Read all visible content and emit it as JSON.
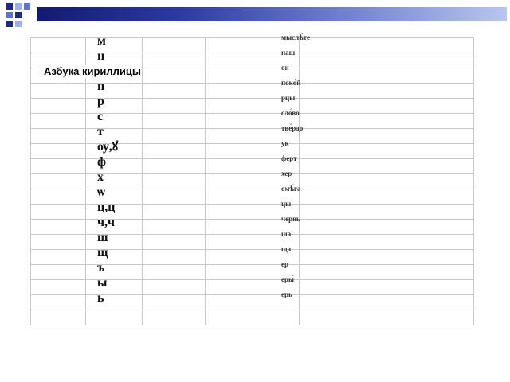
{
  "title": "Азбука кириллицы",
  "theme": {
    "bar_colors": [
      "#131a6e",
      "#b9c6ee"
    ],
    "square_colors": [
      "#1f2a7a",
      "#5f73c8",
      "#9fb0e4"
    ]
  },
  "rows": [
    {
      "letter": "м",
      "name": "мыслѣ́те"
    },
    {
      "letter": "н",
      "name": "наш"
    },
    {
      "letter": "о",
      "name": "он"
    },
    {
      "letter": "п",
      "name": "поко́й"
    },
    {
      "letter": "р",
      "name": "рцы"
    },
    {
      "letter": "с",
      "name": "сло́во"
    },
    {
      "letter": "т",
      "name": "тве́рдо"
    },
    {
      "letter": "ѹ,ꙋ",
      "name": "ук"
    },
    {
      "letter": "ф",
      "name": "ферт"
    },
    {
      "letter": "х",
      "name": "хер"
    },
    {
      "letter": "ѡ",
      "name": "омѣ́га"
    },
    {
      "letter": "ц,ц",
      "name": "цы"
    },
    {
      "letter": "ч,ч",
      "name": "червь"
    },
    {
      "letter": "ш",
      "name": "ша"
    },
    {
      "letter": "щ",
      "name": "ща"
    },
    {
      "letter": "ъ",
      "name": "ер"
    },
    {
      "letter": "ы",
      "name": "еры́"
    },
    {
      "letter": "ь",
      "name": "ерь"
    }
  ]
}
